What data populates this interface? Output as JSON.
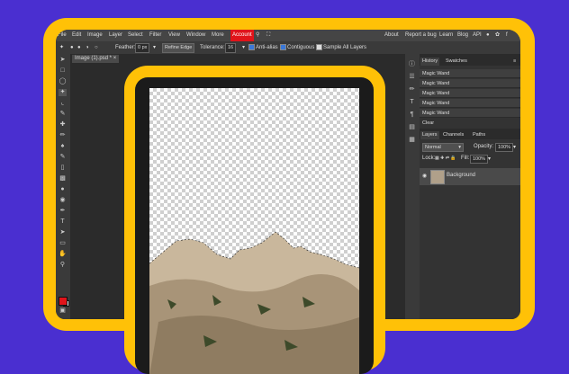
{
  "menu": {
    "items": [
      "File",
      "Edit",
      "Image",
      "Layer",
      "Select",
      "Filter",
      "View",
      "Window",
      "More"
    ],
    "account": "Account",
    "right": [
      "About",
      "Report a bug",
      "Learn",
      "Blog",
      "API"
    ]
  },
  "options": {
    "feather_label": "Feather:",
    "feather_value": "0 px",
    "refine_edge": "Refine Edge",
    "tolerance_label": "Tolerance:",
    "tolerance_value": "16",
    "anti_alias": "Anti-alias",
    "contiguous": "Contiguous",
    "sample_all": "Sample All Layers"
  },
  "document": {
    "tab": "Image (1).psd *"
  },
  "history": {
    "tabs": [
      "History",
      "Swatches"
    ],
    "items": [
      "Magic Wand",
      "Magic Wand",
      "Magic Wand",
      "Magic Wand",
      "Magic Wand"
    ],
    "last": "Clear"
  },
  "layers": {
    "tabs": [
      "Layers",
      "Channels",
      "Paths"
    ],
    "blend_mode": "Normal",
    "opacity_label": "Opacity:",
    "opacity_value": "100%",
    "lock_label": "Lock:",
    "fill_label": "Fill:",
    "fill_value": "100%",
    "layer_name": "Background"
  },
  "colors": {
    "foreground": "#e0141a",
    "background": "#ffffff",
    "frame": "#ffc107",
    "page_bg": "#4a2fd0"
  }
}
